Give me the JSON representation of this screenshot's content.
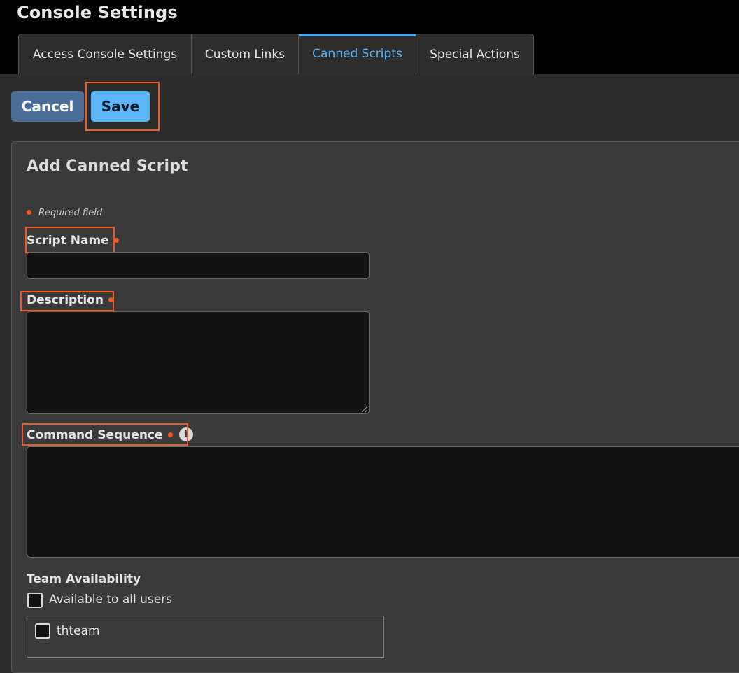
{
  "header": {
    "title": "Console Settings"
  },
  "tabs": [
    {
      "label": "Access Console Settings",
      "active": false
    },
    {
      "label": "Custom Links",
      "active": false
    },
    {
      "label": "Canned Scripts",
      "active": true
    },
    {
      "label": "Special Actions",
      "active": false
    }
  ],
  "toolbar": {
    "cancel_label": "Cancel",
    "save_label": "Save"
  },
  "form": {
    "title": "Add Canned Script",
    "required_note": "Required field",
    "script_name": {
      "label": "Script Name",
      "value": ""
    },
    "description": {
      "label": "Description",
      "value": ""
    },
    "command_sequence": {
      "label": "Command Sequence",
      "value": ""
    },
    "team_availability": {
      "label": "Team Availability",
      "all_users_label": "Available to all users",
      "all_users_checked": false,
      "teams": [
        {
          "name": "thteam",
          "checked": false
        }
      ]
    }
  },
  "colors": {
    "accent": "#4aa8f0",
    "required_dot": "#f05a22",
    "highlight": "#f05a22",
    "cancel_button": "#4a6e96",
    "save_button": "#5ab6f7"
  },
  "icons": {
    "info": "info-icon",
    "required": "required-dot-icon"
  }
}
